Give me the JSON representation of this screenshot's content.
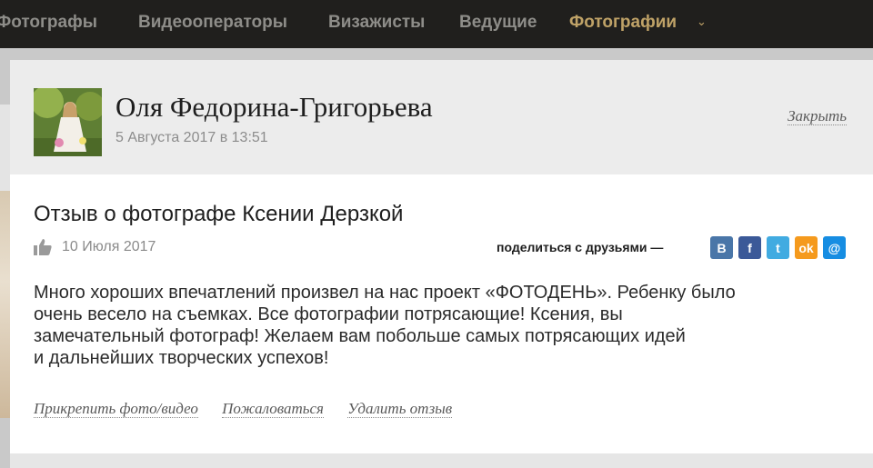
{
  "nav": {
    "items": [
      "Фотографы",
      "Видеооператоры",
      "Визажисты",
      "Ведущие",
      "Фотографии"
    ],
    "active_index": 4,
    "accent_color": "#bfa267"
  },
  "modal": {
    "author": {
      "name": "Оля Федорина-Григорьева",
      "date": "5 Августа 2017 в 13:51"
    },
    "close_label": "Закрыть",
    "review": {
      "title": "Отзыв о фотографе Ксении Дерзкой",
      "date": "10 Июля 2017",
      "share_label": "поделиться с друзьями —",
      "share_icons": [
        {
          "name": "vk-icon",
          "glyph": "B",
          "color": "#4a76a8"
        },
        {
          "name": "facebook-icon",
          "glyph": "f",
          "color": "#3b5998"
        },
        {
          "name": "twitter-icon",
          "glyph": "t",
          "color": "#41abe1"
        },
        {
          "name": "odnoklassniki-icon",
          "glyph": "ok",
          "color": "#f59a1d"
        },
        {
          "name": "mailru-icon",
          "glyph": "@",
          "color": "#168de2"
        }
      ],
      "text_lines": [
        "Много хороших впечатлений произвел на нас проект «ФОТОДЕНЬ». Ребенку было",
        "очень весело на съемках. Все фотографии потрясающие! Ксения, вы",
        "замечательный фотограф! Желаем вам побольше самых потрясающих идей",
        "и дальнейших творческих успехов!"
      ]
    },
    "actions": {
      "attach": "Прикрепить фото/видео",
      "complain": "Пожаловаться",
      "delete": "Удалить отзыв"
    }
  }
}
